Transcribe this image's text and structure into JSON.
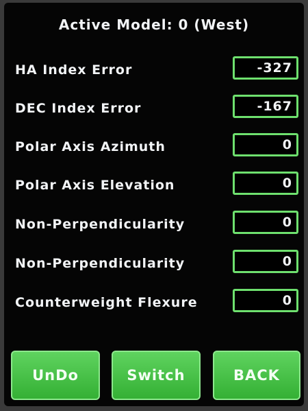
{
  "header": {
    "title": "Active Model: 0 (West)"
  },
  "parameters": [
    {
      "label": "HA Index Error",
      "value": "-327"
    },
    {
      "label": "DEC Index Error",
      "value": "-167"
    },
    {
      "label": "Polar Axis Azimuth",
      "value": "0"
    },
    {
      "label": "Polar Axis Elevation",
      "value": "0"
    },
    {
      "label": "Non-Perpendicularity",
      "value": "0"
    },
    {
      "label": "Non-Perpendicularity",
      "value": "0"
    },
    {
      "label": "Counterweight Flexure",
      "value": "0"
    }
  ],
  "buttons": {
    "undo": "UnDo",
    "switch": "Switch",
    "back": "BACK"
  },
  "colors": {
    "screen_background": "#050505",
    "accent_green": "#6ee06e",
    "button_green": "#4cc44c",
    "text": "#f2f4f6"
  }
}
